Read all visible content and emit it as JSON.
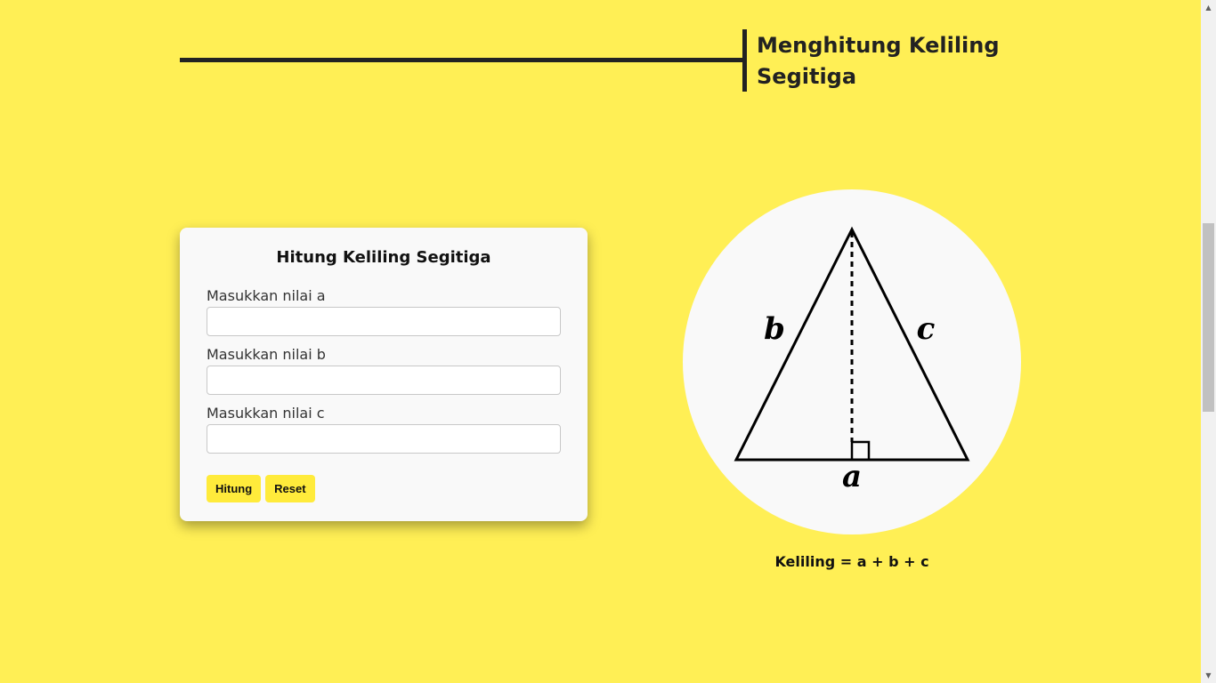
{
  "header": {
    "title": "Menghitung Keliling Segitiga"
  },
  "form": {
    "title": "Hitung Keliling Segitiga",
    "fields": [
      {
        "label": "Masukkan nilai a",
        "value": "",
        "placeholder": ""
      },
      {
        "label": "Masukkan nilai b",
        "value": "",
        "placeholder": ""
      },
      {
        "label": "Masukkan nilai c",
        "value": "",
        "placeholder": ""
      }
    ],
    "buttons": {
      "calculate": "Hitung",
      "reset": "Reset"
    }
  },
  "diagram": {
    "labels": {
      "a": "a",
      "b": "b",
      "c": "c"
    }
  },
  "formula": "Keliling = a + b + c",
  "colors": {
    "background": "#ffef55",
    "accent": "#ffeb3b",
    "card": "#f9f9f9",
    "text": "#222222"
  }
}
